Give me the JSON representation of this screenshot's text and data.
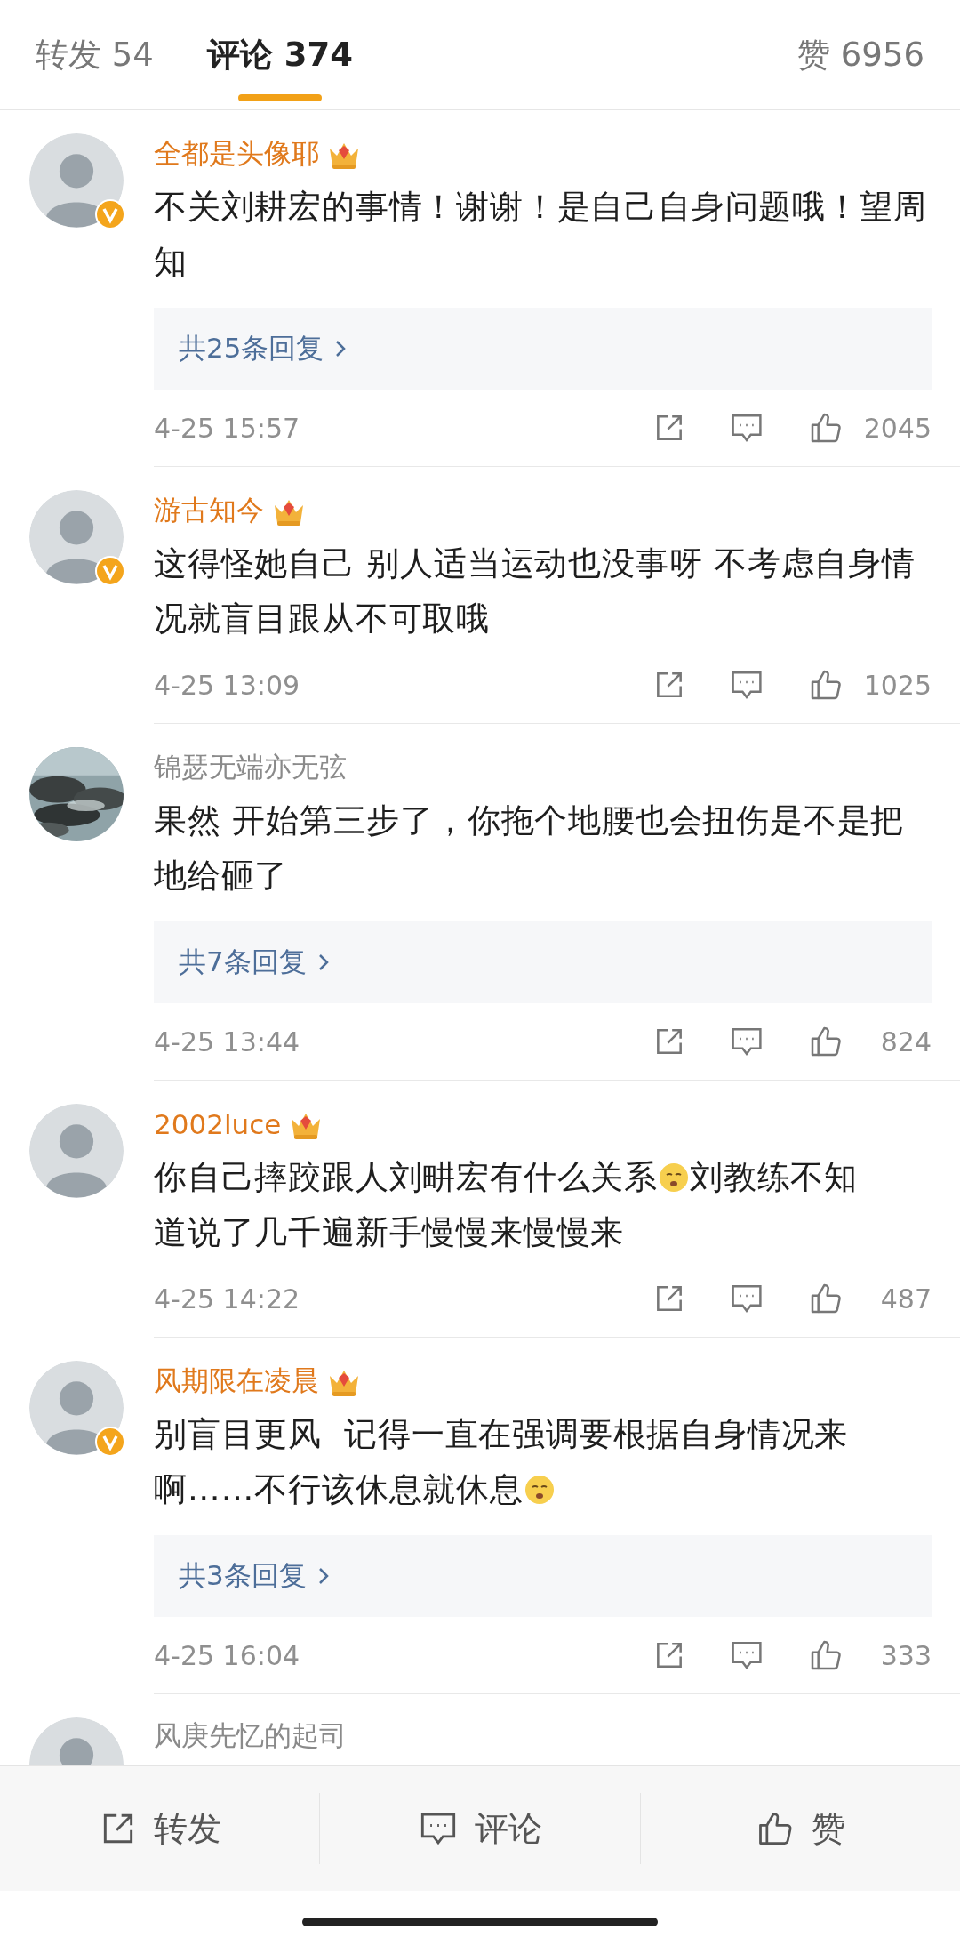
{
  "tabs": [
    {
      "label": "转发 54",
      "selected": false
    },
    {
      "label": "评论 374",
      "selected": true
    },
    {
      "label": "赞 6956",
      "selected": false
    }
  ],
  "comments": [
    {
      "name": "全都是头像耶",
      "vip": true,
      "verified": true,
      "avatar": {
        "kind": "silhouette"
      },
      "body": [
        {
          "kind": "text",
          "text": "不关刘耕宏的事情！谢谢！是自己自身问题哦！望周知"
        }
      ],
      "replies": "共25条回复",
      "time": "4-25 15:57",
      "likes": "2045"
    },
    {
      "name": "游古知今",
      "vip": true,
      "verified": true,
      "avatar": {
        "kind": "silhouette"
      },
      "body": [
        {
          "kind": "text",
          "text": "这得怪她自己 别人适当运动也没事呀 不考虑自身情况就盲目跟从不可取哦"
        }
      ],
      "time": "4-25 13:09",
      "likes": "1025"
    },
    {
      "name": "锦瑟无端亦无弦",
      "vip": false,
      "verified": false,
      "body": [
        {
          "kind": "text",
          "text": "果然 开始第三步了，你拖个地腰也会扭伤是不是把地给砸了"
        }
      ],
      "replies": "共7条回复",
      "time": "4-25 13:44",
      "likes": "824"
    },
    {
      "name": "2002luce",
      "vip": true,
      "verified": false,
      "avatar": {
        "kind": "silhouette"
      },
      "body": [
        {
          "kind": "text",
          "text": "你自己摔跤跟人刘畊宏有什么关系"
        },
        {
          "kind": "emoji"
        },
        {
          "kind": "text",
          "text": "刘教练不知"
        },
        {
          "kind": "break"
        },
        {
          "kind": "text",
          "text": "道说了几千遍新手慢慢来慢慢来"
        }
      ],
      "time": "4-25 14:22",
      "likes": "487"
    },
    {
      "name": "风期限在凌晨",
      "vip": true,
      "verified": true,
      "avatar": {
        "kind": "silhouette"
      },
      "body": [
        {
          "kind": "text",
          "text": "别盲目更风  记得一直在强调要根据自身情况来"
        },
        {
          "kind": "break"
        },
        {
          "kind": "text",
          "text": "啊……不行该休息就休息"
        },
        {
          "kind": "emoji"
        }
      ],
      "replies": "共3条回复",
      "time": "4-25 16:04",
      "likes": "333"
    }
  ],
  "partial_comment": {
    "name": "风庚先忆的起司",
    "avatar": {
      "kind": "silhouette"
    }
  },
  "bottom_bar": [
    {
      "kind": "repost",
      "label": "转发"
    },
    {
      "kind": "comment",
      "label": "评论"
    },
    {
      "kind": "like",
      "label": "赞"
    }
  ]
}
